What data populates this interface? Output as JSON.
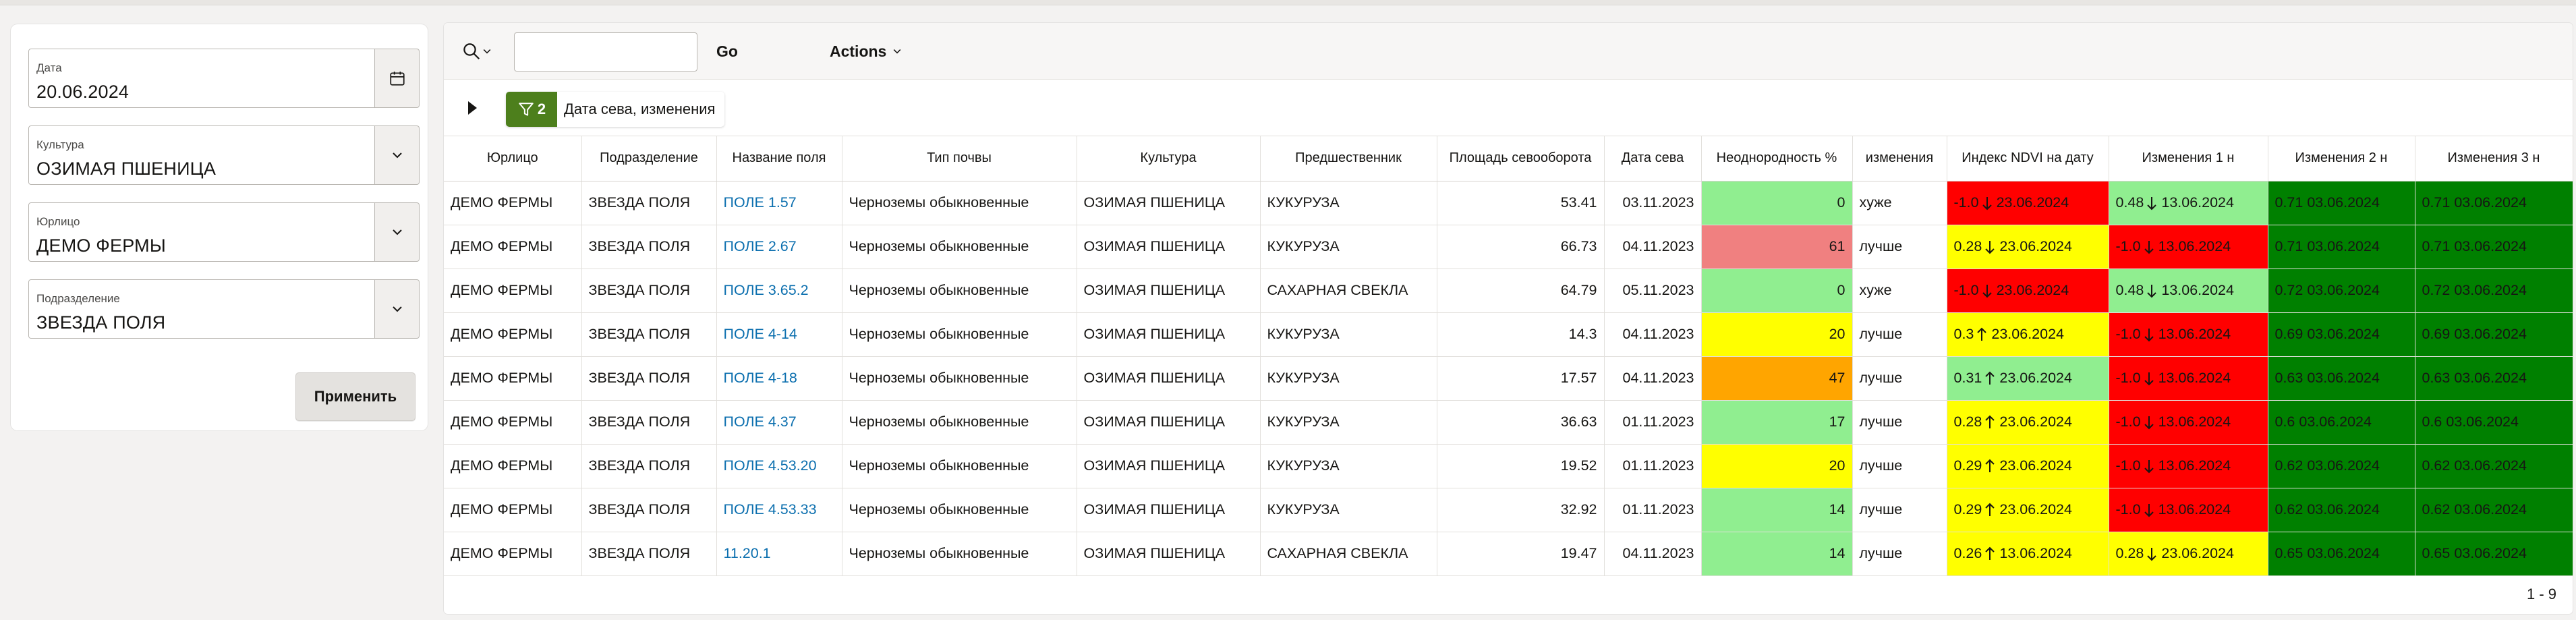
{
  "filters": {
    "date": {
      "label": "Дата",
      "value": "20.06.2024"
    },
    "culture": {
      "label": "Культура",
      "value": "ОЗИМАЯ ПШЕНИЦА"
    },
    "legal_entity": {
      "label": "Юрлицо",
      "value": "ДЕМО ФЕРМЫ"
    },
    "division": {
      "label": "Подразделение",
      "value": "ЗВЕЗДА ПОЛЯ"
    },
    "apply_label": "Применить"
  },
  "toolbar": {
    "search_value": "",
    "go_label": "Go",
    "actions_label": "Actions"
  },
  "active_filter": {
    "count": "2",
    "label": "Дата сева, изменения"
  },
  "table": {
    "headers": [
      "Юрлицо",
      "Подразделение",
      "Название поля",
      "Тип почвы",
      "Культура",
      "Предшественник",
      "Площадь севооборота",
      "Дата сева",
      "Неоднородность %",
      "изменения",
      "Индекс NDVI на дату",
      "Изменения 1 н",
      "Изменения 2 н",
      "Изменения 3 н"
    ],
    "rows": [
      [
        "ДЕМО ФЕРМЫ",
        "ЗВЕЗДА ПОЛЯ",
        "ПОЛЕ 1.57",
        "Черноземы обыкновенные",
        "ОЗИМАЯ ПШЕНИЦА",
        "КУКУРУЗА",
        "53.41",
        "03.11.2023",
        "0",
        "хуже",
        "-1.0",
        "23.06.2024",
        "0.48",
        "13.06.2024",
        "0.71 03.06.2024",
        "0.71 03.06.2024"
      ],
      [
        "ДЕМО ФЕРМЫ",
        "ЗВЕЗДА ПОЛЯ",
        "ПОЛЕ 2.67",
        "Черноземы обыкновенные",
        "ОЗИМАЯ ПШЕНИЦА",
        "КУКУРУЗА",
        "66.73",
        "04.11.2023",
        "61",
        "лучше",
        "0.28",
        "23.06.2024",
        "-1.0",
        "13.06.2024",
        "0.71 03.06.2024",
        "0.71 03.06.2024"
      ],
      [
        "ДЕМО ФЕРМЫ",
        "ЗВЕЗДА ПОЛЯ",
        "ПОЛЕ 3.65.2",
        "Черноземы обыкновенные",
        "ОЗИМАЯ ПШЕНИЦА",
        "САХАРНАЯ СВЕКЛА",
        "64.79",
        "05.11.2023",
        "0",
        "хуже",
        "-1.0",
        "23.06.2024",
        "0.48",
        "13.06.2024",
        "0.72 03.06.2024",
        "0.72 03.06.2024"
      ],
      [
        "ДЕМО ФЕРМЫ",
        "ЗВЕЗДА ПОЛЯ",
        "ПОЛЕ 4-14",
        "Черноземы обыкновенные",
        "ОЗИМАЯ ПШЕНИЦА",
        "КУКУРУЗА",
        "14.3",
        "04.11.2023",
        "20",
        "лучше",
        "0.3",
        "23.06.2024",
        "-1.0",
        "13.06.2024",
        "0.69 03.06.2024",
        "0.69 03.06.2024"
      ],
      [
        "ДЕМО ФЕРМЫ",
        "ЗВЕЗДА ПОЛЯ",
        "ПОЛЕ 4-18",
        "Черноземы обыкновенные",
        "ОЗИМАЯ ПШЕНИЦА",
        "КУКУРУЗА",
        "17.57",
        "04.11.2023",
        "47",
        "лучше",
        "0.31",
        "23.06.2024",
        "-1.0",
        "13.06.2024",
        "0.63 03.06.2024",
        "0.63 03.06.2024"
      ],
      [
        "ДЕМО ФЕРМЫ",
        "ЗВЕЗДА ПОЛЯ",
        "ПОЛЕ 4.37",
        "Черноземы обыкновенные",
        "ОЗИМАЯ ПШЕНИЦА",
        "КУКУРУЗА",
        "36.63",
        "01.11.2023",
        "17",
        "лучше",
        "0.28",
        "23.06.2024",
        "-1.0",
        "13.06.2024",
        "0.6 03.06.2024",
        "0.6 03.06.2024"
      ],
      [
        "ДЕМО ФЕРМЫ",
        "ЗВЕЗДА ПОЛЯ",
        "ПОЛЕ 4.53.20",
        "Черноземы обыкновенные",
        "ОЗИМАЯ ПШЕНИЦА",
        "КУКУРУЗА",
        "19.52",
        "01.11.2023",
        "20",
        "лучше",
        "0.29",
        "23.06.2024",
        "-1.0",
        "13.06.2024",
        "0.62 03.06.2024",
        "0.62 03.06.2024"
      ],
      [
        "ДЕМО ФЕРМЫ",
        "ЗВЕЗДА ПОЛЯ",
        "ПОЛЕ 4.53.33",
        "Черноземы обыкновенные",
        "ОЗИМАЯ ПШЕНИЦА",
        "КУКУРУЗА",
        "32.92",
        "01.11.2023",
        "14",
        "лучше",
        "0.29",
        "23.06.2024",
        "-1.0",
        "13.06.2024",
        "0.62 03.06.2024",
        "0.62 03.06.2024"
      ],
      [
        "ДЕМО ФЕРМЫ",
        "ЗВЕЗДА ПОЛЯ",
        "11.20.1",
        "Черноземы обыкновенные",
        "ОЗИМАЯ ПШЕНИЦА",
        "САХАРНАЯ СВЕКЛА",
        "19.47",
        "04.11.2023",
        "14",
        "лучше",
        "0.26",
        "13.06.2024",
        "0.28",
        "23.06.2024",
        "0.65 03.06.2024",
        "0.65 03.06.2024"
      ]
    ],
    "cell_styles": {
      "heterogeneity_colors": [
        "#90ee90",
        "#f08080",
        "#90ee90",
        "#ffff00",
        "#ffa500",
        "#90ee90",
        "#ffff00",
        "#90ee90",
        "#90ee90"
      ],
      "ndvi_colors": [
        "#ff0000",
        "#ffff00",
        "#ff0000",
        "#ffff00",
        "#90ee90",
        "#ffff00",
        "#ffff00",
        "#ffff00",
        "#ffff00"
      ],
      "ndvi_arrows": [
        "down",
        "down",
        "down",
        "up",
        "up",
        "up",
        "up",
        "up",
        "up"
      ],
      "change1_colors": [
        "#90ee90",
        "#ff0000",
        "#90ee90",
        "#ff0000",
        "#ff0000",
        "#ff0000",
        "#ff0000",
        "#ff0000",
        "#ffff00"
      ],
      "change1_arrows": [
        "down",
        "down",
        "down",
        "down",
        "down",
        "down",
        "down",
        "down",
        "down"
      ],
      "change23_color": "#008000"
    }
  },
  "pagination": "1 - 9"
}
